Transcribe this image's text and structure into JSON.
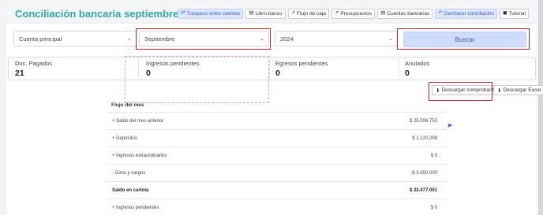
{
  "header": {
    "title": "Conciliación bancaria septiembre - 2024",
    "buttons": [
      {
        "label": "Traspaso entre cuentas",
        "icon": "⇄",
        "highlight": true
      },
      {
        "label": "Libro banco",
        "icon": "▤",
        "highlight": false
      },
      {
        "label": "Flujo de caja",
        "icon": "↗",
        "highlight": false
      },
      {
        "label": "Presupuestos",
        "icon": "↗",
        "highlight": false
      },
      {
        "label": "Cuentas bancarias",
        "icon": "▤",
        "highlight": false
      },
      {
        "label": "Deshacer conciliación",
        "icon": "↶",
        "highlight": true
      },
      {
        "label": "Tutorial",
        "icon": "◼",
        "highlight": false
      }
    ]
  },
  "filters": {
    "cuenta": "Cuenta principal",
    "mes": "Septiembre",
    "anio": "2024",
    "buscar_label": "Buscar"
  },
  "stats": {
    "pagados_label": "Doc. Pagados",
    "pagados_value": "21",
    "ingresos_label": "Ingresos pendientes",
    "ingresos_value": "0",
    "egresos_label": "Egresos pendientes",
    "egresos_value": "0",
    "anulados_label": "Anulados",
    "anulados_value": "0"
  },
  "downloads": {
    "comprobante_label": "Descargar comprobante",
    "excel_label": "Descargar Excel"
  },
  "flow": {
    "title": "Flujo del mes",
    "rows": [
      {
        "label": "+ Saldo del mes anterior",
        "value": "$ 25.006.753",
        "bold": false
      },
      {
        "label": "+ Depósitos",
        "value": "$ 1.120.298",
        "bold": false
      },
      {
        "label": "+ Ingresos extraordinarios",
        "value": "$ 0",
        "bold": false
      },
      {
        "label": "- Giros y cargos",
        "value": "-$ 3.650.000",
        "bold": false
      },
      {
        "label": "Saldo en cartola",
        "value": "$ 22.477.051",
        "bold": true
      },
      {
        "label": "+ Ingresos pendientes",
        "value": "$ 0",
        "bold": false
      }
    ]
  },
  "colors": {
    "accent": "#30a7a0",
    "primary_button": "#cfdcfa",
    "highlight_box": "#b3262e"
  }
}
